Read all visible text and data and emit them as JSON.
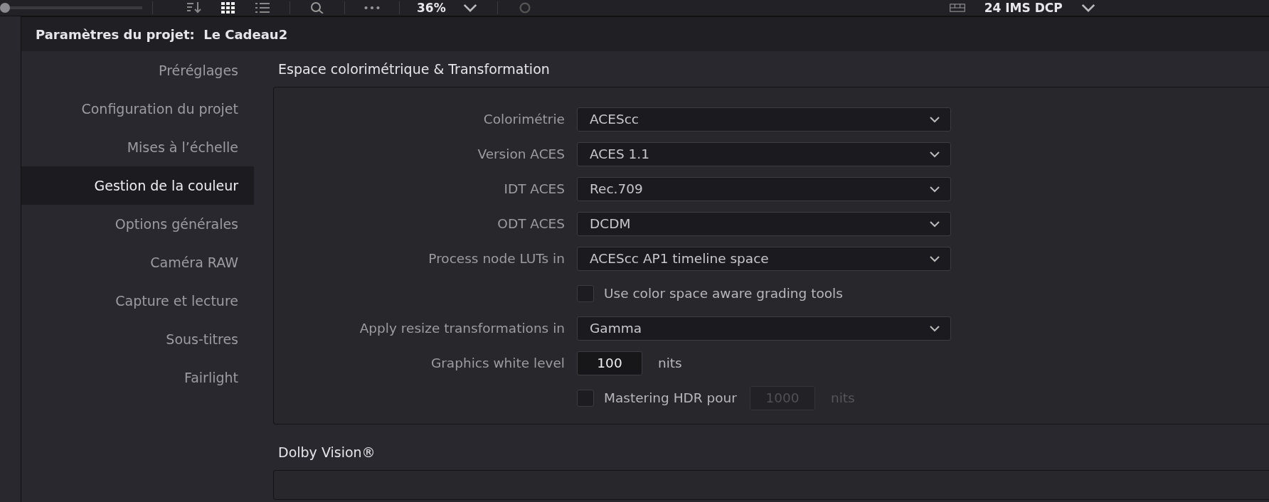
{
  "toolbar": {
    "slider": {
      "level": 0
    },
    "zoom": "36%",
    "timeline": "24 IMS DCP"
  },
  "dialog": {
    "title": "Paramètres du projet:  Le Cadeau2",
    "sidebar": {
      "items": [
        {
          "label": "Préréglages",
          "selected": false
        },
        {
          "label": "Configuration du projet",
          "selected": false
        },
        {
          "label": "Mises à l’échelle",
          "selected": false
        },
        {
          "label": "Gestion de la couleur",
          "selected": true
        },
        {
          "label": "Options générales",
          "selected": false
        },
        {
          "label": "Caméra RAW",
          "selected": false
        },
        {
          "label": "Capture et lecture",
          "selected": false
        },
        {
          "label": "Sous-titres",
          "selected": false
        },
        {
          "label": "Fairlight",
          "selected": false
        }
      ]
    },
    "sections": [
      {
        "title": "Espace colorimétrique & Transformation",
        "rows": [
          {
            "kind": "dropdown",
            "label": "Colorimétrie",
            "value": "ACEScc"
          },
          {
            "kind": "dropdown",
            "label": "Version ACES",
            "value": "ACES 1.1"
          },
          {
            "kind": "dropdown",
            "label": "IDT ACES",
            "value": "Rec.709"
          },
          {
            "kind": "dropdown",
            "label": "ODT ACES",
            "value": "DCDM"
          },
          {
            "kind": "dropdown",
            "label": "Process node LUTs in",
            "value": "ACEScc AP1 timeline space"
          },
          {
            "kind": "checkbox",
            "label": "Use color space aware grading tools",
            "checked": false
          },
          {
            "kind": "dropdown",
            "label": "Apply resize transformations in",
            "value": "Gamma"
          },
          {
            "kind": "number",
            "label": "Graphics white level",
            "value": "100",
            "unit": "nits",
            "disabled": false
          },
          {
            "kind": "checkbox_number",
            "label": "Mastering HDR pour",
            "checked": false,
            "value": "1000",
            "unit": "nits",
            "disabled": true
          }
        ]
      },
      {
        "title": "Dolby Vision®"
      }
    ]
  }
}
